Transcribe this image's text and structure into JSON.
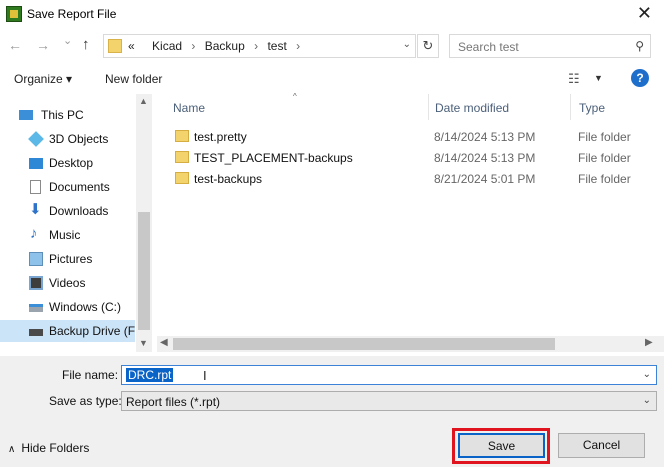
{
  "window": {
    "title": "Save Report File",
    "close_glyph": "✕"
  },
  "nav": {
    "back_glyph": "←",
    "forward_glyph": "→",
    "history_glyph": "⌄",
    "up_glyph": "↑",
    "breadcrumb": {
      "prefix": "«",
      "parts": [
        "Kicad",
        "Backup",
        "test"
      ]
    },
    "refresh_glyph": "↻",
    "search_placeholder": "Search test"
  },
  "toolbar": {
    "organize_label": "Organize ▾",
    "new_folder_label": "New folder"
  },
  "tree": {
    "items": [
      {
        "label": "This PC",
        "icon": "pc-icon"
      },
      {
        "label": "3D Objects",
        "icon": "cube-icon"
      },
      {
        "label": "Desktop",
        "icon": "desktop-icon"
      },
      {
        "label": "Documents",
        "icon": "document-icon"
      },
      {
        "label": "Downloads",
        "icon": "download-icon"
      },
      {
        "label": "Music",
        "icon": "music-icon"
      },
      {
        "label": "Pictures",
        "icon": "picture-icon"
      },
      {
        "label": "Videos",
        "icon": "video-icon"
      },
      {
        "label": "Windows (C:)",
        "icon": "drive-icon"
      },
      {
        "label": "Backup Drive (F:",
        "icon": "drive-icon"
      }
    ]
  },
  "list": {
    "columns": [
      "Name",
      "Date modified",
      "Type"
    ],
    "rows": [
      {
        "name": "test.pretty",
        "date": "8/14/2024 5:13 PM",
        "type": "File folder"
      },
      {
        "name": "TEST_PLACEMENT-backups",
        "date": "8/14/2024 5:13 PM",
        "type": "File folder"
      },
      {
        "name": "test-backups",
        "date": "8/21/2024 5:01 PM",
        "type": "File folder"
      }
    ]
  },
  "form": {
    "file_name_label": "File name:",
    "file_name_value": "DRC.rpt",
    "save_as_type_label": "Save as type:",
    "save_as_type_value": "Report files (*.rpt)"
  },
  "footer": {
    "hide_folders_label": "Hide Folders",
    "save_label": "Save",
    "cancel_label": "Cancel"
  },
  "colors": {
    "accent": "#0a64c8",
    "highlight_outline": "#e0141e",
    "selection": "#cce4f7"
  }
}
